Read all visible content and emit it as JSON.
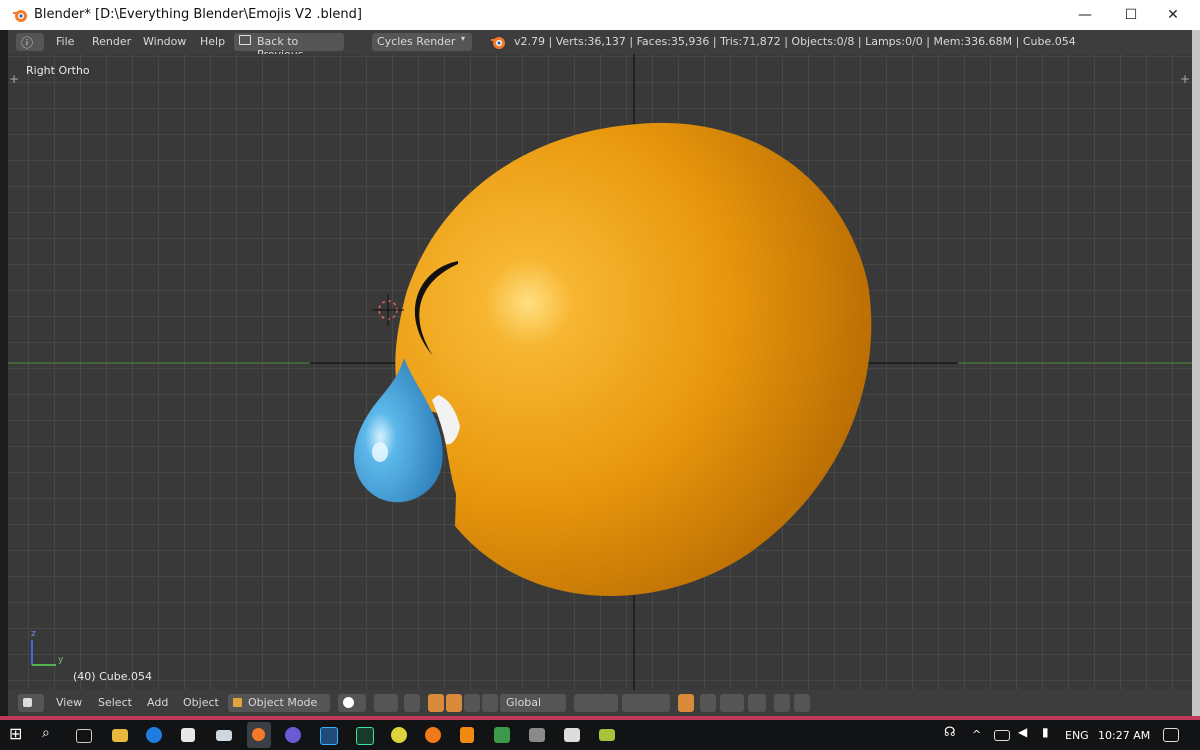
{
  "window": {
    "title": "Blender* [D:\\Everything Blender\\Emojis V2 .blend]",
    "minimize_glyph": "—",
    "maximize_glyph": "☐",
    "close_glyph": "✕"
  },
  "menu": {
    "info_glyph": "ⓘ",
    "items": [
      "File",
      "Render",
      "Window",
      "Help"
    ],
    "back_label": "Back to Previous",
    "engine": "Cycles Render",
    "stats": "v2.79 | Verts:36,137 | Faces:35,936 | Tris:71,872 | Objects:0/8 | Lamps:0/0 | Mem:336.68M | Cube.054"
  },
  "viewport": {
    "view_name": "Right Ortho",
    "object_label": "(40) Cube.054",
    "axis_z": "z",
    "axis_y": "y"
  },
  "footer": {
    "view": "View",
    "select": "Select",
    "add": "Add",
    "object": "Object",
    "mode": "Object Mode",
    "orientation": "Global"
  },
  "taskbar": {
    "language": "ENG",
    "time": "10:27 AM"
  },
  "colors": {
    "emoji_face": "#f2a41a",
    "teardrop": "#4aa6dc",
    "x_axis_line": "#4f8a3a",
    "blender_orange": "#f5792a"
  }
}
